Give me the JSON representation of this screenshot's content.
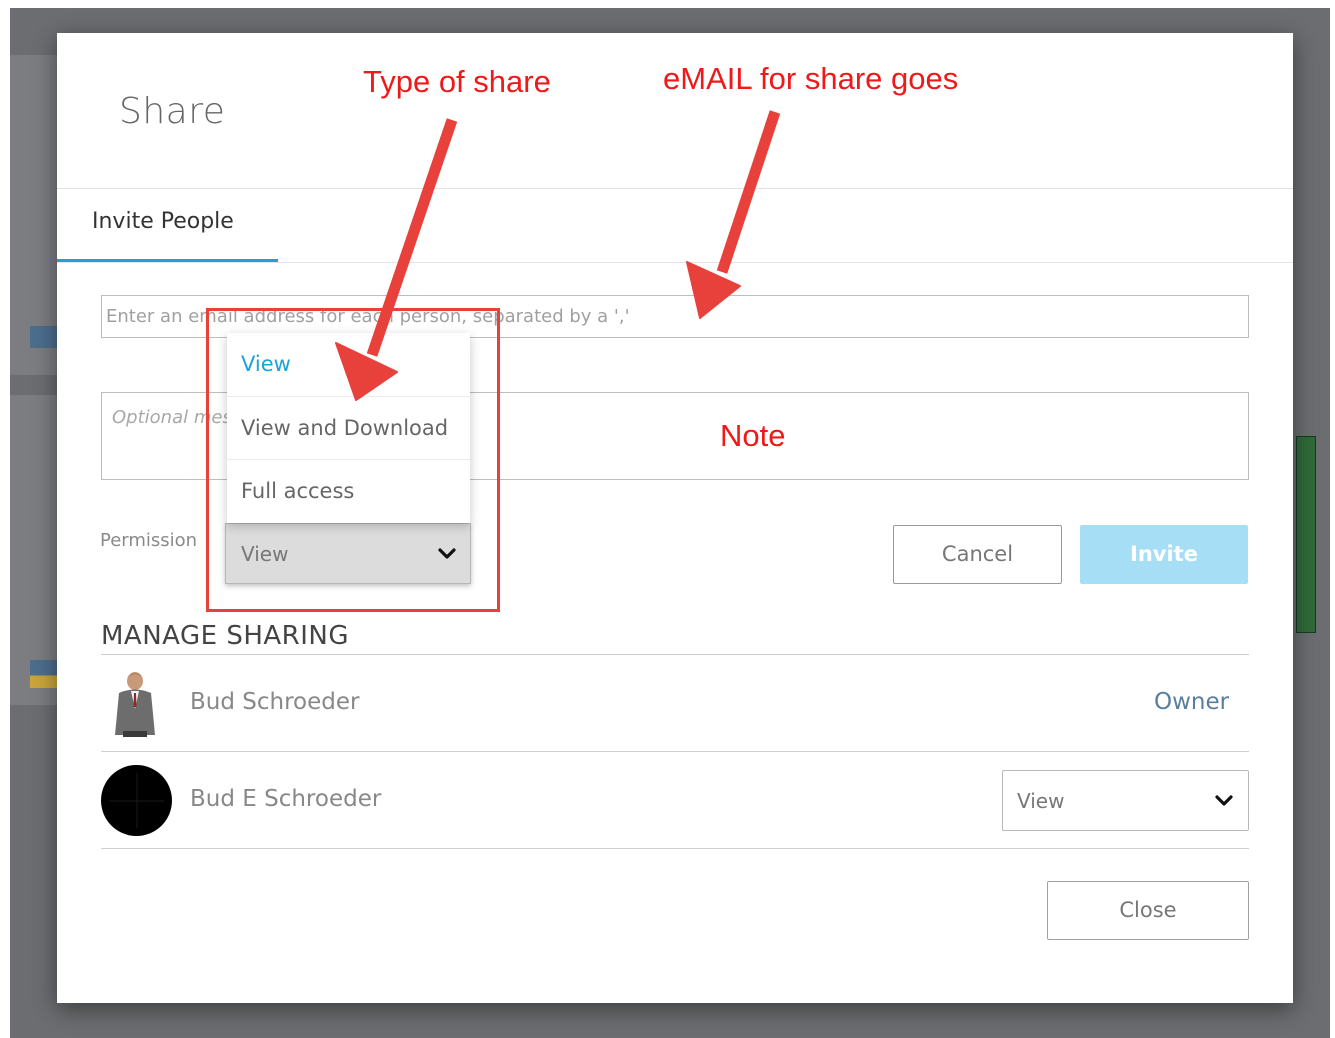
{
  "dialog": {
    "title": "Share",
    "tab_label": "Invite People",
    "email_placeholder": "Enter an email address for each person, separated by a ','",
    "message_placeholder": "Optional message",
    "permission_label": "Permission",
    "permission_selected": "View",
    "permission_options": [
      "View",
      "View and Download",
      "Full access"
    ],
    "cancel_label": "Cancel",
    "invite_label": "Invite",
    "close_label": "Close"
  },
  "manage_sharing": {
    "heading": "MANAGE SHARING",
    "users": [
      {
        "name": "Bud Schroeder",
        "role": "Owner"
      },
      {
        "name": "Bud E Schroeder",
        "permission": "View"
      }
    ]
  },
  "annotations": {
    "type_of_share": "Type of share",
    "email_for_share": "eMAIL for share goes",
    "note": "Note",
    "color": "#f01919"
  },
  "colors": {
    "accent": "#1ca3d9",
    "invite_disabled": "#a6dff5",
    "annotation_red": "#e8413c"
  }
}
